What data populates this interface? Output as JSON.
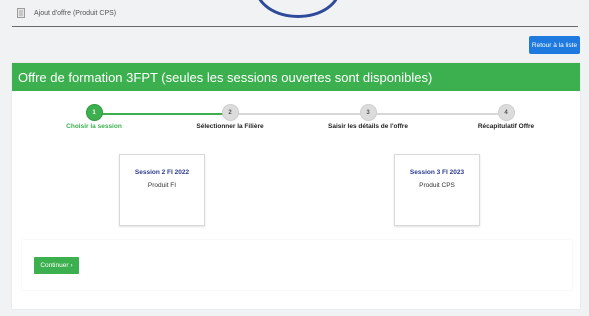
{
  "breadcrumb": {
    "icon": "document-icon",
    "text": "Ajout d'offre (Produit CPS)"
  },
  "toolbar": {
    "back_label": "Retour à la liste"
  },
  "main": {
    "title": "Offre de formation 3FPT (seules les sessions ouvertes sont disponibles)"
  },
  "stepper": {
    "steps": [
      {
        "number": "1",
        "label": "Choisir la session",
        "active": true
      },
      {
        "number": "2",
        "label": "Sélectionner la Filière",
        "active": false
      },
      {
        "number": "3",
        "label": "Saisir les détails de l'offre",
        "active": false
      },
      {
        "number": "4",
        "label": "Récapitulatif Offre",
        "active": false
      }
    ]
  },
  "sessions": [
    {
      "title": "Session 2 FI 2022",
      "product": "Produit FI"
    },
    {
      "title": "Session 3 FI 2023",
      "product": "Produit CPS"
    }
  ],
  "footer": {
    "continue_label": "Continuer"
  },
  "colors": {
    "accent_green": "#3cb04f",
    "button_blue": "#1f7ae0",
    "session_title": "#2a3a8f"
  }
}
